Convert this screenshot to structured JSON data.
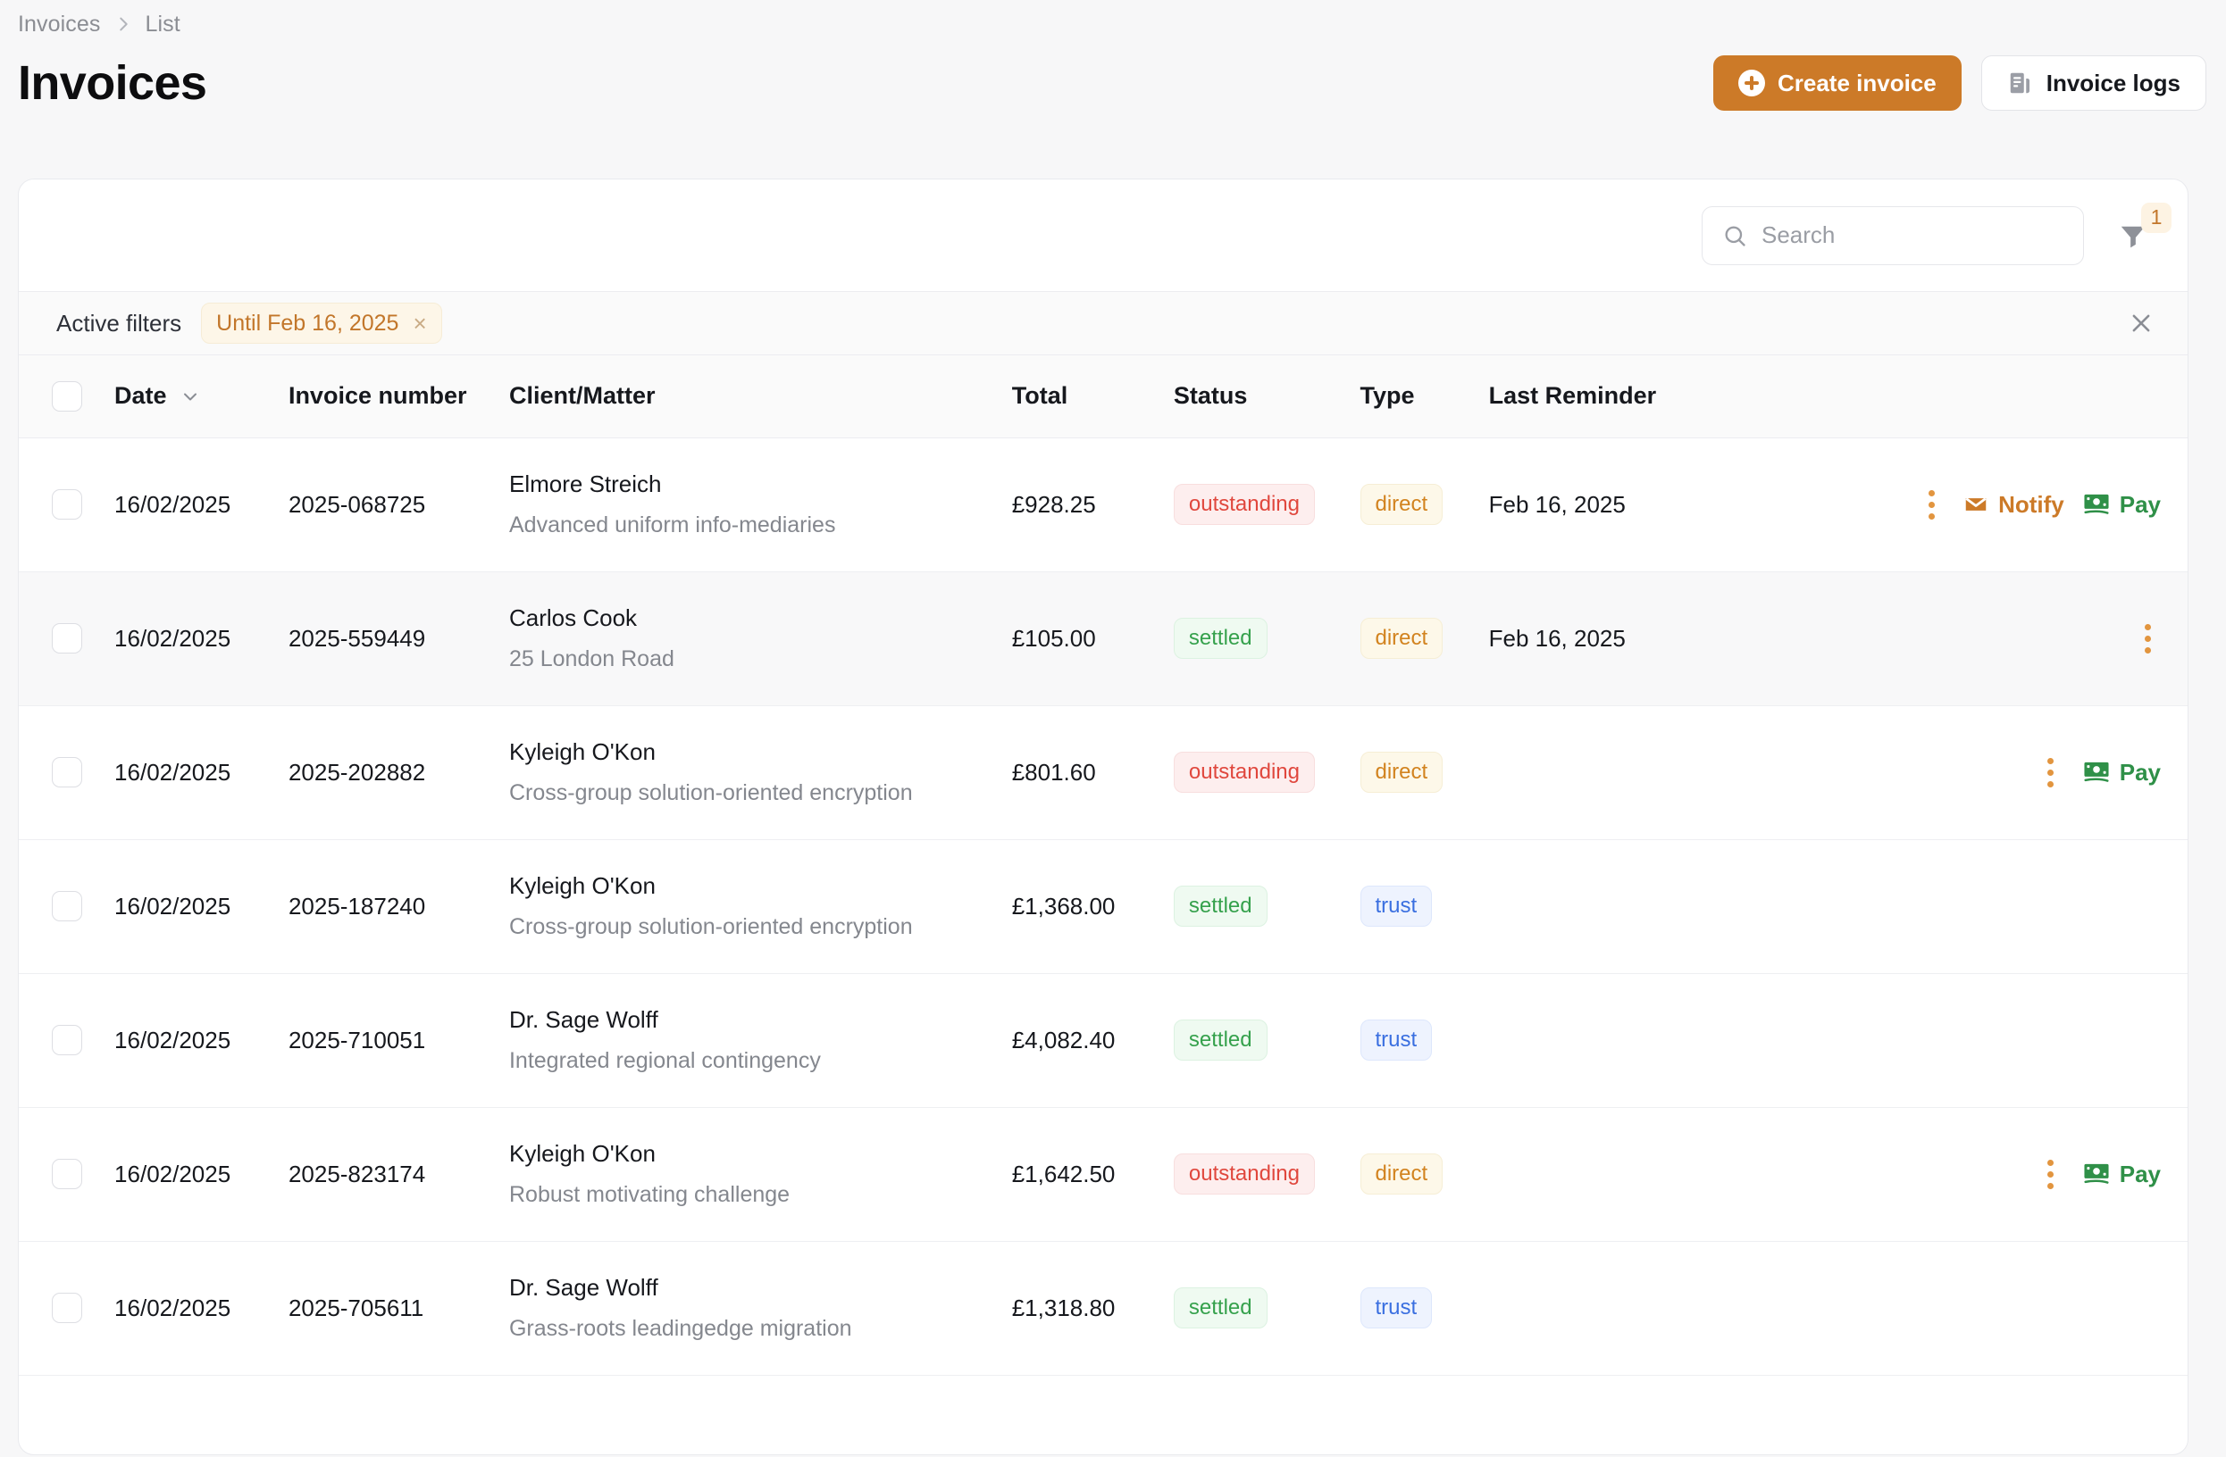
{
  "breadcrumb": {
    "root": "Invoices",
    "current": "List",
    "separator_icon": "chevron-right-icon"
  },
  "header": {
    "title": "Invoices",
    "create_label": "Create invoice",
    "logs_label": "Invoice logs"
  },
  "toolbar": {
    "search_placeholder": "Search",
    "search_value": "",
    "filter_badge": "1"
  },
  "active_filters": {
    "label": "Active filters",
    "chips": [
      {
        "label": "Until Feb 16, 2025",
        "remove": "×"
      }
    ],
    "clear_all": "×"
  },
  "table": {
    "columns": [
      {
        "key": "check",
        "label": ""
      },
      {
        "key": "date",
        "label": "Date",
        "sort_icon": "chevron-down-icon"
      },
      {
        "key": "number",
        "label": "Invoice number"
      },
      {
        "key": "client",
        "label": "Client/Matter"
      },
      {
        "key": "total",
        "label": "Total"
      },
      {
        "key": "status",
        "label": "Status"
      },
      {
        "key": "type",
        "label": "Type"
      },
      {
        "key": "reminder",
        "label": "Last Reminder"
      },
      {
        "key": "actions",
        "label": ""
      }
    ],
    "rows": [
      {
        "date": "16/02/2025",
        "number": "2025-068725",
        "client": "Elmore Streich",
        "matter": "Advanced uniform info-mediaries",
        "total": "£928.25",
        "status": "outstanding",
        "type": "direct",
        "reminder": "Feb 16, 2025",
        "highlight": false,
        "actions": {
          "kebab": true,
          "notify": "Notify",
          "pay": "Pay"
        }
      },
      {
        "date": "16/02/2025",
        "number": "2025-559449",
        "client": "Carlos Cook",
        "matter": "25 London Road",
        "total": "£105.00",
        "status": "settled",
        "type": "direct",
        "reminder": "Feb 16, 2025",
        "highlight": true,
        "actions": {
          "kebab": true,
          "notify": "",
          "pay": ""
        }
      },
      {
        "date": "16/02/2025",
        "number": "2025-202882",
        "client": "Kyleigh O'Kon",
        "matter": "Cross-group solution-oriented encryption",
        "total": "£801.60",
        "status": "outstanding",
        "type": "direct",
        "reminder": "",
        "highlight": false,
        "actions": {
          "kebab": true,
          "notify": "",
          "pay": "Pay"
        }
      },
      {
        "date": "16/02/2025",
        "number": "2025-187240",
        "client": "Kyleigh O'Kon",
        "matter": "Cross-group solution-oriented encryption",
        "total": "£1,368.00",
        "status": "settled",
        "type": "trust",
        "reminder": "",
        "highlight": false,
        "actions": {
          "kebab": false,
          "notify": "",
          "pay": ""
        }
      },
      {
        "date": "16/02/2025",
        "number": "2025-710051",
        "client": "Dr. Sage Wolff",
        "matter": "Integrated regional contingency",
        "total": "£4,082.40",
        "status": "settled",
        "type": "trust",
        "reminder": "",
        "highlight": false,
        "actions": {
          "kebab": false,
          "notify": "",
          "pay": ""
        }
      },
      {
        "date": "16/02/2025",
        "number": "2025-823174",
        "client": "Kyleigh O'Kon",
        "matter": "Robust motivating challenge",
        "total": "£1,642.50",
        "status": "outstanding",
        "type": "direct",
        "reminder": "",
        "highlight": false,
        "actions": {
          "kebab": true,
          "notify": "",
          "pay": "Pay"
        }
      },
      {
        "date": "16/02/2025",
        "number": "2025-705611",
        "client": "Dr. Sage Wolff",
        "matter": "Grass-roots leadingedge migration",
        "total": "£1,318.80",
        "status": "settled",
        "type": "trust",
        "reminder": "",
        "highlight": false,
        "actions": {
          "kebab": false,
          "notify": "",
          "pay": ""
        }
      }
    ]
  },
  "colors": {
    "accent": "#cc7a28",
    "outstanding": "#e0473d",
    "settled": "#35a14c",
    "direct": "#d2831f",
    "trust": "#3a6fe0",
    "pay": "#2f9048"
  }
}
